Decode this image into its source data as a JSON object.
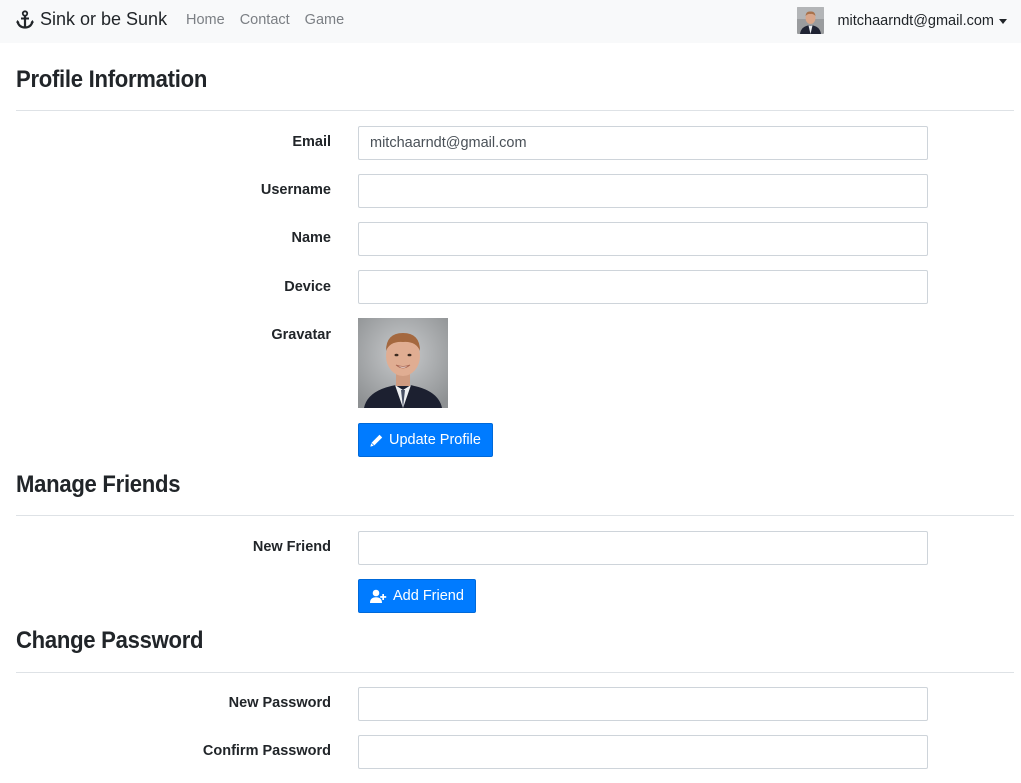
{
  "navbar": {
    "brand": "Sink or be Sunk",
    "brand_icon": "anchor-icon",
    "links": [
      "Home",
      "Contact",
      "Game"
    ],
    "user_email": "mitchaarndt@gmail.com"
  },
  "profile": {
    "title": "Profile Information",
    "email_label": "Email",
    "email_value": "mitchaarndt@gmail.com",
    "username_label": "Username",
    "username_value": "",
    "name_label": "Name",
    "name_value": "",
    "device_label": "Device",
    "device_value": "",
    "gravatar_label": "Gravatar",
    "update_button": "Update Profile",
    "update_icon": "pencil-icon"
  },
  "friends": {
    "title": "Manage Friends",
    "new_friend_label": "New Friend",
    "new_friend_value": "",
    "add_button": "Add Friend",
    "add_icon": "user-plus-icon"
  },
  "password": {
    "title": "Change Password",
    "new_password_label": "New Password",
    "confirm_password_label": "Confirm Password"
  },
  "colors": {
    "primary": "#007bff",
    "navbar_bg": "#f8f9fa",
    "nav_link": "#7b7f84"
  }
}
